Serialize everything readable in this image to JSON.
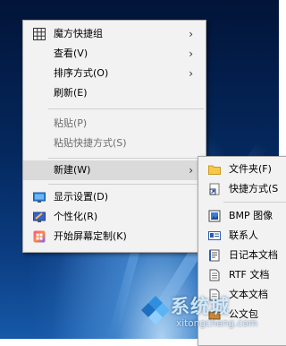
{
  "context_menu": {
    "items": [
      {
        "label": "魔方快捷组",
        "icon": "grid-icon",
        "has_submenu": true
      },
      {
        "label": "查看(V)",
        "has_submenu": true
      },
      {
        "label": "排序方式(O)",
        "has_submenu": true
      },
      {
        "label": "刷新(E)"
      },
      {
        "label": "粘贴(P)",
        "disabled": true
      },
      {
        "label": "粘贴快捷方式(S)",
        "disabled": true
      },
      {
        "label": "新建(W)",
        "has_submenu": true,
        "highlighted": true
      },
      {
        "label": "显示设置(D)",
        "icon": "display-icon"
      },
      {
        "label": "个性化(R)",
        "icon": "personalize-icon"
      },
      {
        "label": "开始屏幕定制(K)",
        "icon": "start-screen-icon"
      }
    ]
  },
  "new_submenu": {
    "items": [
      {
        "label": "文件夹(F)",
        "icon": "folder-icon"
      },
      {
        "label": "快捷方式(S",
        "icon": "shortcut-icon"
      },
      {
        "label": "BMP 图像",
        "icon": "bmp-image-icon"
      },
      {
        "label": "联系人",
        "icon": "contact-icon"
      },
      {
        "label": "日记本文档",
        "icon": "journal-icon"
      },
      {
        "label": "RTF 文档",
        "icon": "rtf-document-icon"
      },
      {
        "label": "文本文档",
        "icon": "text-document-icon"
      },
      {
        "label": "公文包",
        "icon": "briefcase-icon"
      }
    ]
  },
  "watermark": {
    "text": "系统城",
    "url": "xitongcheng.com"
  },
  "colors": {
    "menu_bg": "#f2f2f2",
    "highlight": "#dadada",
    "disabled_text": "#6d6d6d",
    "desktop_dark": "#04285e",
    "desktop_light": "#1659a8"
  }
}
